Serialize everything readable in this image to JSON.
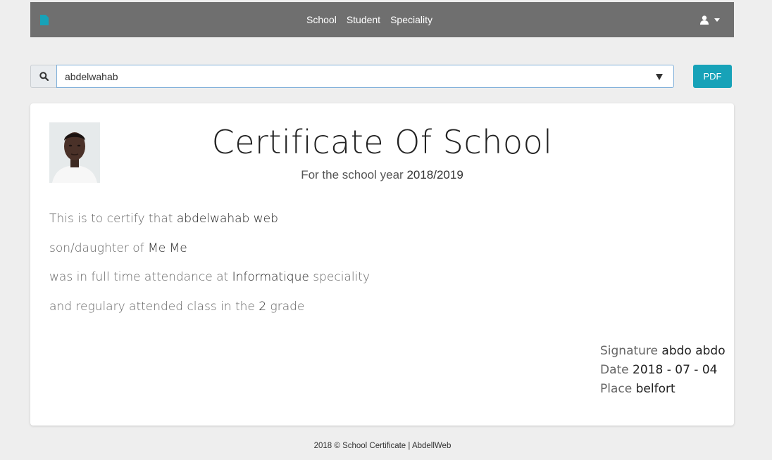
{
  "navbar": {
    "brand_icon": "file-icon",
    "links": [
      "School",
      "Student",
      "Speciality"
    ],
    "user_icon": "user-icon"
  },
  "search": {
    "icon": "search-icon",
    "selected_value": "abdelwahab",
    "pdf_label": "PDF"
  },
  "certificate": {
    "title": "Certificate Of School",
    "subtitle_prefix": "For the school year ",
    "school_year": "2018/2019",
    "lines": [
      {
        "prefix": "This is to certify that ",
        "value": "abdelwahab web",
        "suffix": ""
      },
      {
        "prefix": "son/daughter of ",
        "value": "Me Me",
        "suffix": ""
      },
      {
        "prefix": "was in full time attendance at ",
        "value": "Informatique",
        "suffix": " speciality"
      },
      {
        "prefix": "and regulary attended class in the ",
        "value": "2",
        "suffix": " grade"
      }
    ],
    "signature_label": "Signature ",
    "signature_value": "abdo abdo",
    "date_label": "Date ",
    "date_value": "2018 - 07 - 04",
    "place_label": "Place ",
    "place_value": "belfort"
  },
  "footer": {
    "text": "2018 © School Certificate | AbdellWeb"
  },
  "colors": {
    "navbar": "#6f6f6f",
    "accent": "#17a2b8",
    "background": "#eeeeee"
  }
}
